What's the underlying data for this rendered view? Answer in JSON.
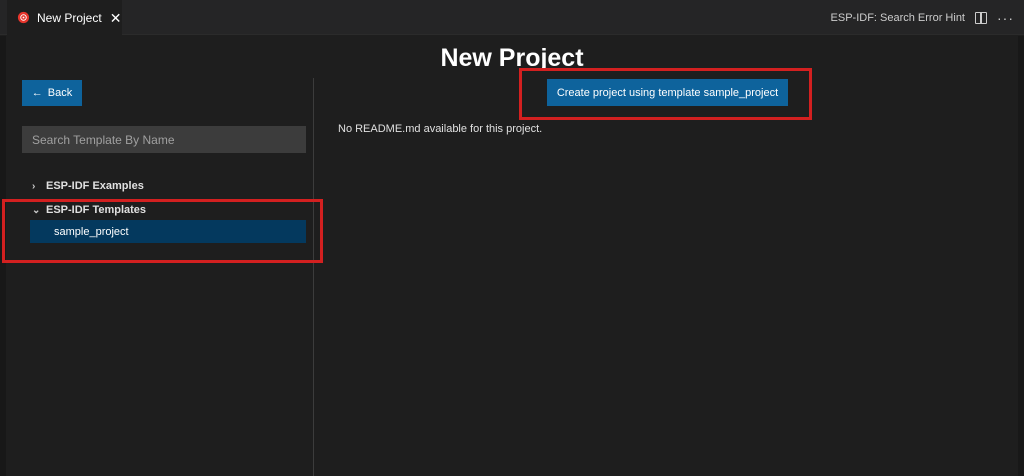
{
  "tab": {
    "title": "New Project",
    "icon": "esp-idf-icon",
    "close_glyph": "✕"
  },
  "toolbar": {
    "label": "ESP-IDF: Search Error Hint",
    "more_glyph": "···"
  },
  "page": {
    "title": "New Project"
  },
  "sidebar": {
    "back_label": "Back",
    "back_glyph": "←",
    "search_placeholder": "Search Template By Name",
    "tree": [
      {
        "label": "ESP-IDF Examples",
        "expanded": false,
        "chevron": "›"
      },
      {
        "label": "ESP-IDF Templates",
        "expanded": true,
        "chevron": "⌄",
        "children": [
          "sample_project"
        ]
      }
    ]
  },
  "main": {
    "create_label": "Create project using template sample_project",
    "readme_text": "No README.md available for this project."
  },
  "colors": {
    "accent": "#0e639c",
    "selected": "#04395e",
    "highlight": "#d32020",
    "background": "#1e1e1e"
  }
}
